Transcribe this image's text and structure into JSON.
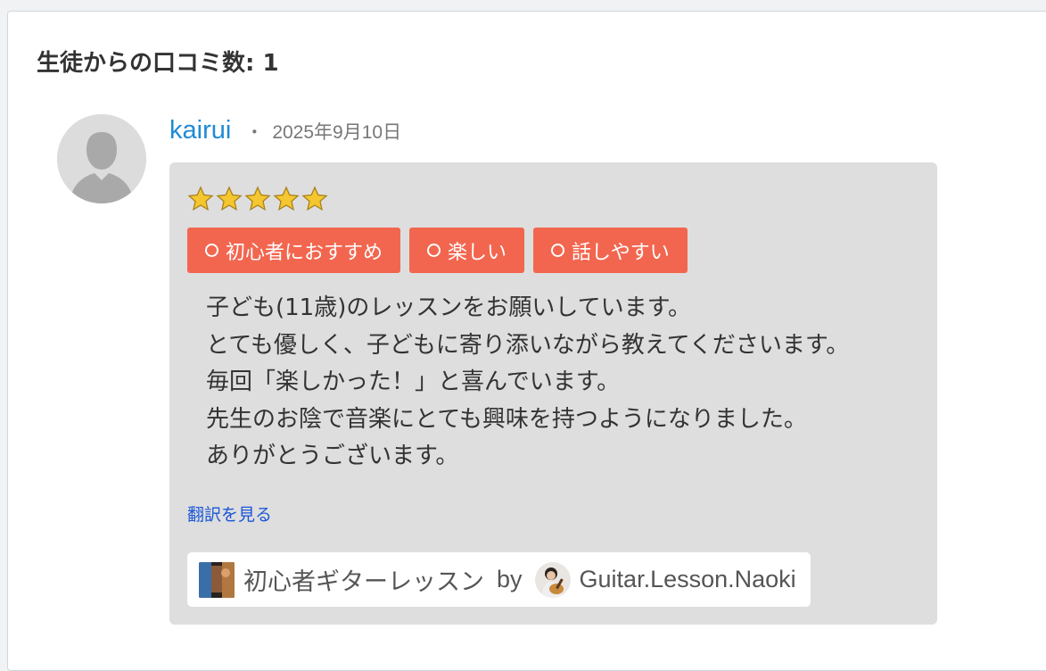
{
  "reviews_section": {
    "count_label": "生徒からの口コミ数: 1"
  },
  "review": {
    "reviewer_name": "kairui",
    "separator": "・",
    "date": "2025年9月10日",
    "rating": 5,
    "tags": [
      "初心者におすすめ",
      "楽しい",
      "話しやすい"
    ],
    "text_lines": [
      "子ども(11歳)のレッスンをお願いしています。",
      "とても優しく、子どもに寄り添いながら教えてくださいます。",
      "毎回「楽しかった！」と喜んでいます。",
      "先生のお陰で音楽にとても興味を持つようになりました。",
      "ありがとうございます。"
    ],
    "translate_link": "翻訳を見る",
    "lesson": {
      "title": "初心者ギターレッスン",
      "by": "by",
      "teacher": "Guitar.Lesson.Naoki"
    }
  },
  "colors": {
    "accent_tag": "#f2664f",
    "name_link": "#1f8ad6",
    "translate_link": "#1a56d8",
    "review_bg": "#dedede"
  },
  "icons": {
    "avatar": "default-user-silhouette-icon",
    "star": "gold-star-icon",
    "tag_marker": "circle-icon"
  }
}
